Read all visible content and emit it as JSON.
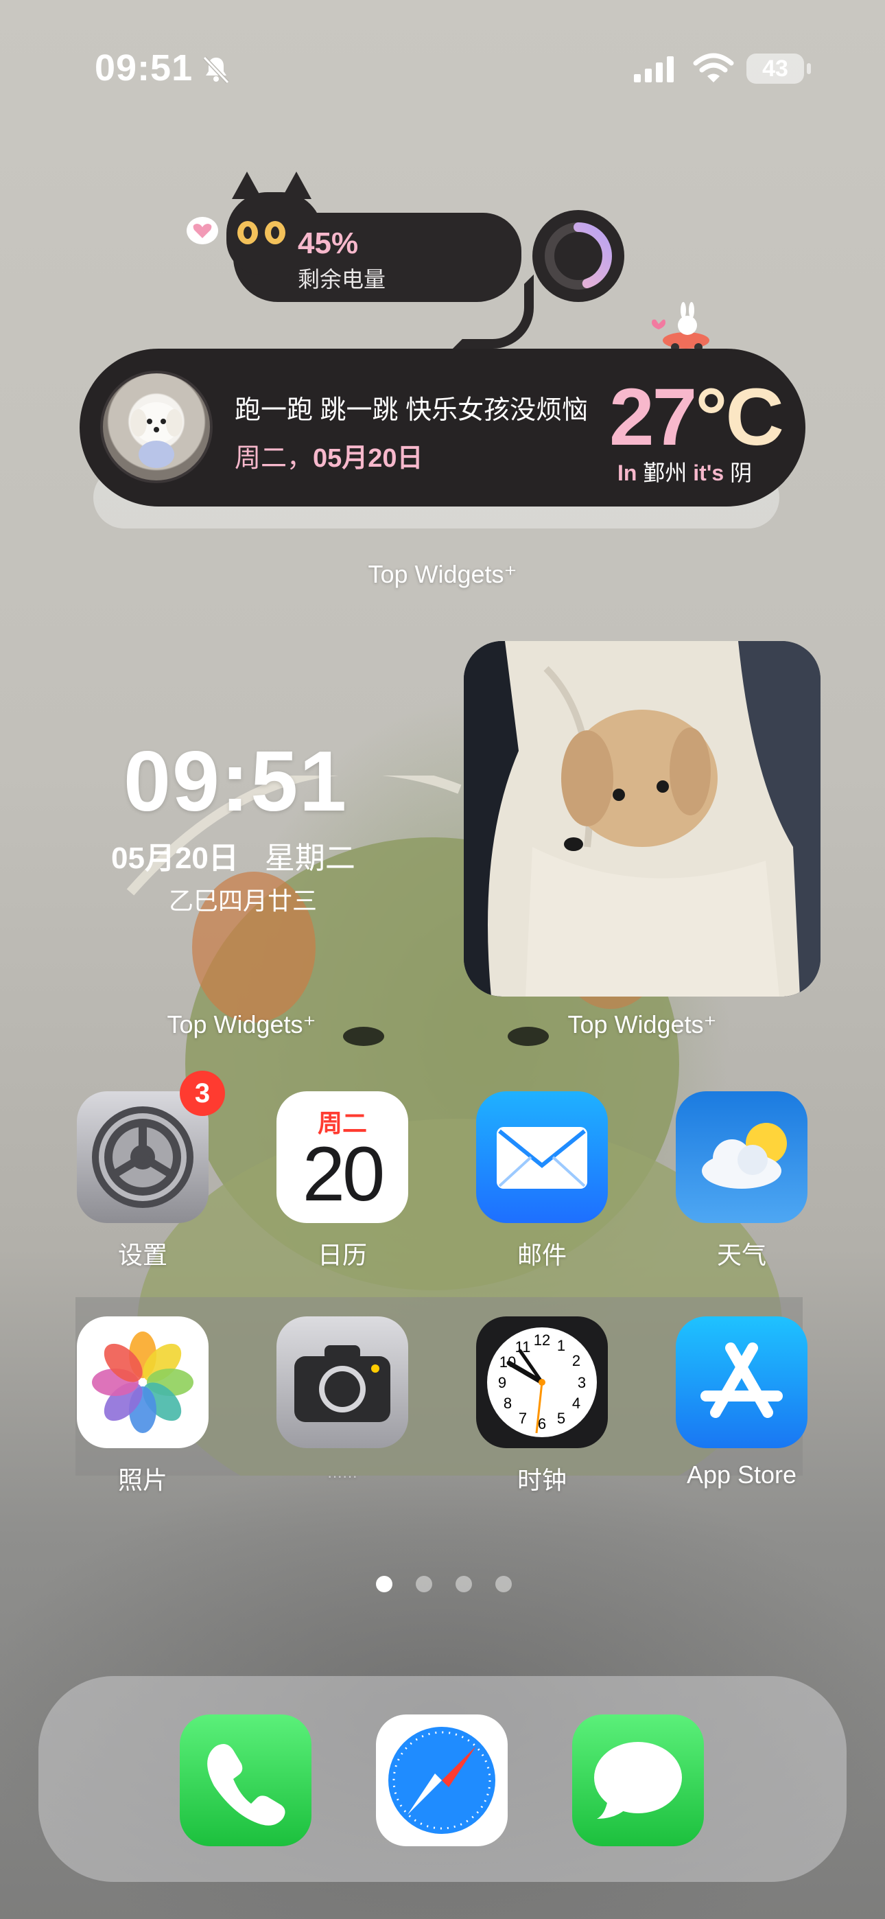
{
  "status_bar": {
    "time": "09:51",
    "battery": "43"
  },
  "battery_widget": {
    "percent": "45%",
    "label": "剩余电量",
    "level": 0.45
  },
  "weather_widget": {
    "slogan": "跑一跑 跳一跳 快乐女孩没烦恼",
    "weekday": "周二，",
    "date": "05月20日",
    "temp_number": "27",
    "temp_unit": "°C",
    "loc_prefix": "In",
    "city": " 鄞州 ",
    "loc_mid": "it's",
    "condition": " 阴"
  },
  "widget_labels": {
    "top": "Top Widgets⁺",
    "clock": "Top Widgets⁺",
    "photo": "Top Widgets⁺"
  },
  "clock_widget": {
    "time": "09:51",
    "date": "05月20日",
    "weekday": "星期二",
    "lunar": "乙巳四月廿三"
  },
  "apps": {
    "settings": {
      "label": "设置",
      "badge": "3"
    },
    "calendar": {
      "label": "日历",
      "day_name": "周二",
      "day": "20"
    },
    "mail": {
      "label": "邮件"
    },
    "weather": {
      "label": "天气"
    },
    "photos": {
      "label": "照片"
    },
    "camera": {
      "label": "······"
    },
    "clock": {
      "label": "时钟"
    },
    "appstore": {
      "label": "App Store"
    }
  },
  "page_dots": {
    "count": 4,
    "active": 0
  },
  "colors": {
    "pink": "#f7b8cc",
    "cream": "#fbe6c4",
    "widget_dark": "#262324",
    "badge_red": "#ff3b30",
    "ios_blue": "#1e8bff",
    "ios_green": "#2fd158"
  },
  "icons": [
    "bell-slash-icon",
    "signal-icon",
    "wifi-icon",
    "battery-icon",
    "phone-icon",
    "safari-icon",
    "messages-icon"
  ]
}
